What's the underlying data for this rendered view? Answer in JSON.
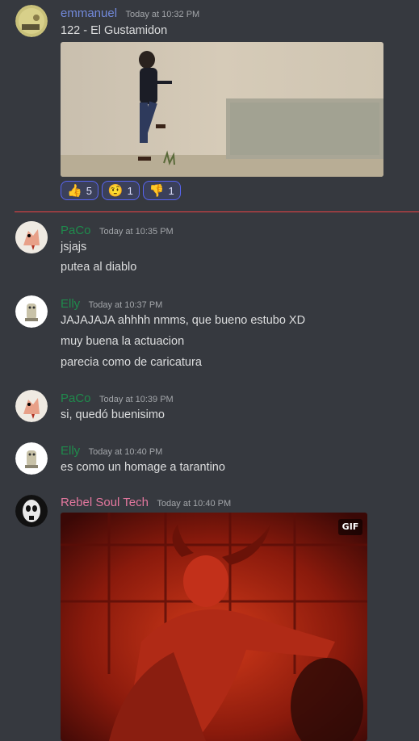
{
  "messages": [
    {
      "author": "emmanuel",
      "author_color": "#7289da",
      "timestamp": "Today at 10:32 PM",
      "lines": [
        "122 - El Gustamidon"
      ],
      "embed": "video-thumbnail",
      "reactions": [
        {
          "emoji": "👍",
          "count": "5"
        },
        {
          "emoji": "🤨",
          "count": "1"
        },
        {
          "emoji": "👎",
          "count": "1"
        }
      ]
    },
    {
      "author": "PaCo",
      "author_color": "#1f8b4c",
      "timestamp": "Today at 10:35 PM",
      "lines": [
        "jsjajs",
        "putea al diablo"
      ]
    },
    {
      "author": "Elly",
      "author_color": "#1f8b4c",
      "timestamp": "Today at 10:37 PM",
      "lines": [
        "JAJAJAJA ahhhh nmms, que bueno estubo XD",
        "muy buena la actuacion",
        "parecia como de caricatura"
      ]
    },
    {
      "author": "PaCo",
      "author_color": "#1f8b4c",
      "timestamp": "Today at 10:39 PM",
      "lines": [
        "si, quedó buenisimo"
      ]
    },
    {
      "author": "Elly",
      "author_color": "#1f8b4c",
      "timestamp": "Today at 10:40 PM",
      "lines": [
        "es como un homage a tarantino"
      ]
    },
    {
      "author": "Rebel Soul Tech",
      "author_color": "#e3779e",
      "timestamp": "Today at 10:40 PM",
      "embed": "gif",
      "gif_badge": "GIF"
    }
  ]
}
